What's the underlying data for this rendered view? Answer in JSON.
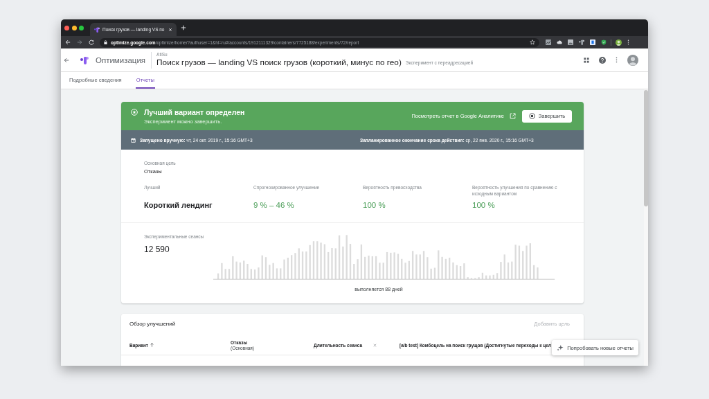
{
  "browser": {
    "tab_title": "Поиск грузов — landing VS по",
    "url_host": "optimize.google.com",
    "url_path": "/optimize/home/?authuser=1&hl=ru#/accounts/1912111329/containers/7725188/experiments/72/report"
  },
  "app_header": {
    "product": "Оптимизация",
    "account": "AtiSu",
    "title": "Поиск грузов — landing VS поиск грузов (короткий, минус по гео)",
    "subtitle": "Эксперимент с переадресацией"
  },
  "tabs": [
    {
      "label": "Подробные сведения",
      "selected": false
    },
    {
      "label": "Отчеты",
      "selected": true
    }
  ],
  "banner": {
    "title": "Лучший вариант определен",
    "message": "Эксперимент можно завершить.",
    "analytics_link": "Посмотреть отчет в Google Аналитике",
    "end_button": "Завершить"
  },
  "schedule": [
    "**Запущено вручную:** чт, 24 окт. 2019 г., 15:16 GMT+3",
    "**Запланированное окончание срока действия:** ср, 22 янв. 2020 г., 15:16 GMT+3"
  ],
  "objective": {
    "label": "Основная цель",
    "value": "Отказы"
  },
  "metrics": [
    {
      "label": "Лучший",
      "value": "Короткий лендинг",
      "kind": "variant"
    },
    {
      "label": "Спрогнозированное улучшение",
      "value": "9 % – 46 %",
      "kind": "positive"
    },
    {
      "label": "Вероятность превосходства",
      "value": "100 %",
      "kind": "positive"
    },
    {
      "label": "Вероятность улучшения по сравнению с исходным вариантом",
      "value": "100 %",
      "kind": "positive"
    }
  ],
  "sessions": {
    "label": "Экспериментальные сеансы",
    "value": "12 590",
    "caption": "выполняется 88 дней"
  },
  "improvements": {
    "title": "Обзор улучшений",
    "add_goal": {
      "label": "Добавить цель",
      "disabled": true
    },
    "columns": [
      {
        "label": "Вариант",
        "sorted": true,
        "removable": false
      },
      {
        "label": "Отказы",
        "sublabel": "(Основная)",
        "sorted": false,
        "removable": false
      },
      {
        "label": "Длительность сеанса",
        "sorted": false,
        "removable": true
      },
      {
        "label": "[a/b test] Комбоцель на поиск грущов (Достигнутые переходы к цел",
        "sorted": false,
        "removable": false
      }
    ]
  },
  "new_reports_button": "Попробовать новые отчеты"
}
